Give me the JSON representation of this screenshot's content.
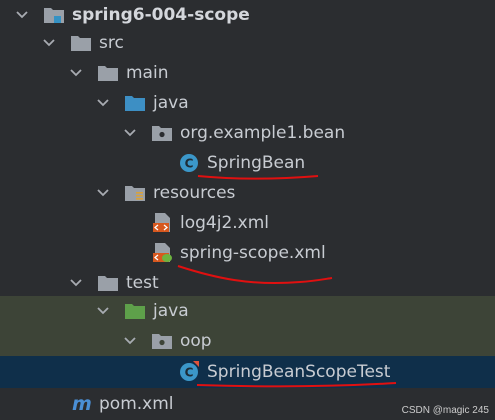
{
  "tree": {
    "project": "spring6-004-scope",
    "src": "src",
    "main": "main",
    "main_java": "java",
    "package_main": "org.example1.bean",
    "spring_bean": "SpringBean",
    "resources": "resources",
    "log4j2": "log4j2.xml",
    "spring_scope": "spring-scope.xml",
    "test": "test",
    "test_java": "java",
    "package_test": "oop",
    "scope_test": "SpringBeanScopeTest",
    "pom": "pom.xml",
    "pom_icon_letter": "m"
  },
  "class_icon_letter": "C",
  "colors": {
    "background": "#2b2d30",
    "test_row": "#3d4437",
    "selected_row": "#0f2f4a",
    "annotation_red": "#e01010"
  },
  "icons": {
    "project": "module-folder-icon",
    "folder": "folder-icon",
    "source_root": "source-folder-icon",
    "test_root": "test-folder-icon",
    "package": "package-icon",
    "class": "class-icon",
    "resources": "resources-folder-icon",
    "xml": "xml-file-icon",
    "spring_xml": "spring-xml-icon",
    "maven": "maven-icon"
  },
  "watermark": "CSDN @magic 245"
}
